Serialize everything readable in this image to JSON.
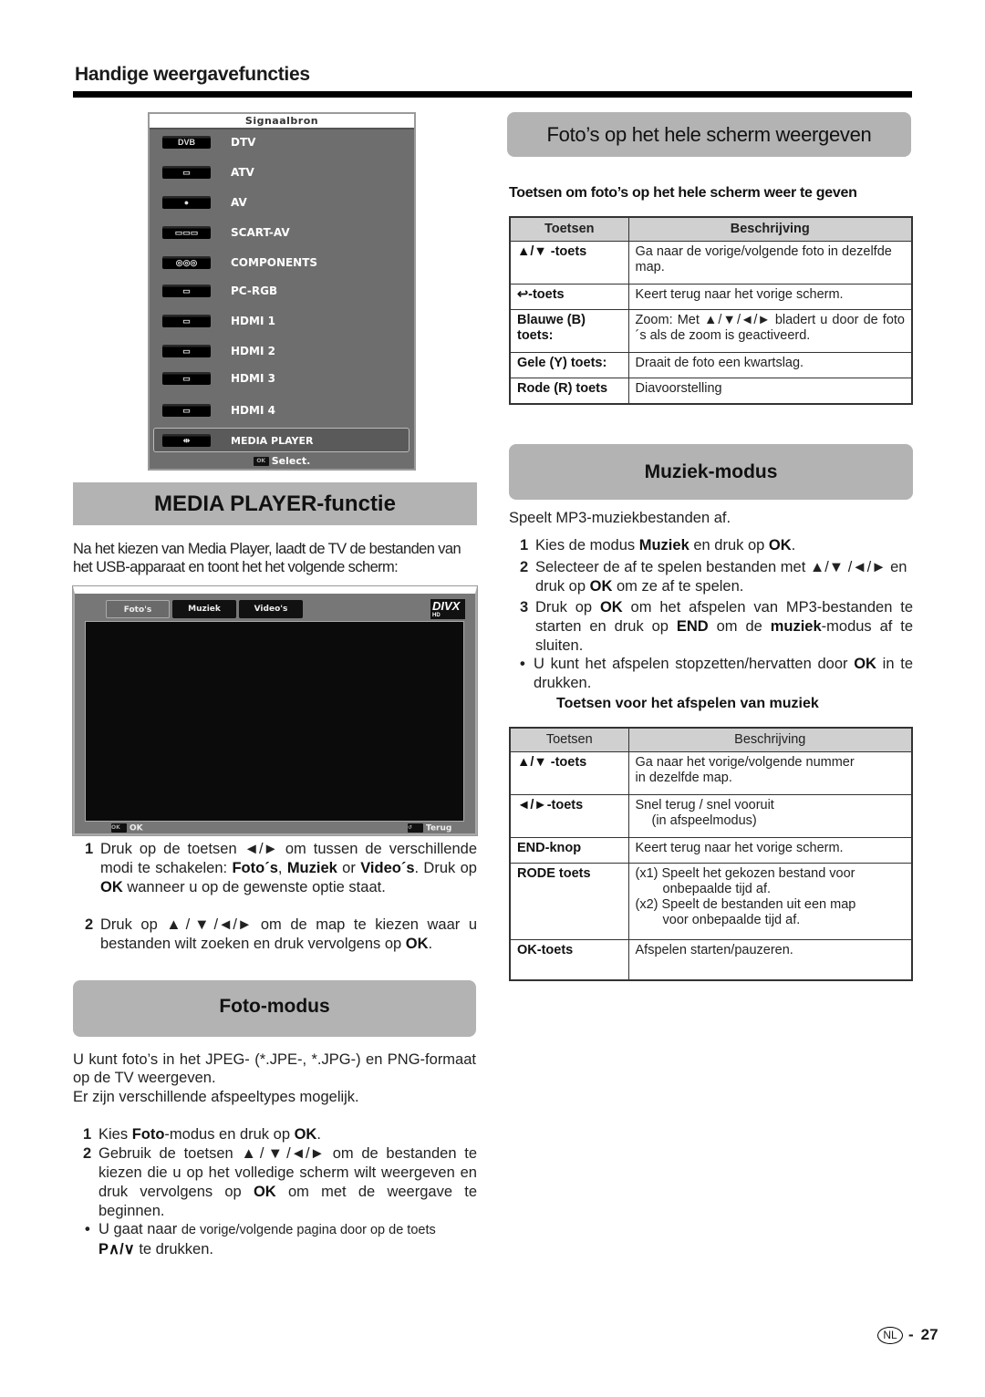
{
  "header": {
    "title": "Handige weergavefuncties"
  },
  "source_menu": {
    "title": "Signaalbron",
    "items": [
      {
        "icon": "dvb-icon",
        "glyph": "DVB",
        "label": "DTV"
      },
      {
        "icon": "tv-icon",
        "glyph": "▭",
        "label": "ATV"
      },
      {
        "icon": "av-jack-icon",
        "glyph": "●",
        "label": "AV"
      },
      {
        "icon": "scart-icon",
        "glyph": "▭▭▭",
        "label": "SCART-AV"
      },
      {
        "icon": "component-icon",
        "glyph": "◎◎◎",
        "label": "COMPONENTS"
      },
      {
        "icon": "vga-icon",
        "glyph": "▭",
        "label": "PC-RGB"
      },
      {
        "icon": "hdmi-icon",
        "glyph": "▭",
        "label": "HDMI 1"
      },
      {
        "icon": "hdmi-icon",
        "glyph": "▭",
        "label": "HDMI 2"
      },
      {
        "icon": "hdmi-icon",
        "glyph": "▭",
        "label": "HDMI 3"
      },
      {
        "icon": "hdmi-icon",
        "glyph": "▭",
        "label": "HDMI 4"
      },
      {
        "icon": "usb-icon",
        "glyph": "⇹",
        "label": "MEDIA PLAYER"
      }
    ],
    "selected": "MEDIA PLAYER",
    "footer_key": "OK",
    "footer_label": "Select."
  },
  "media_player": {
    "title": "MEDIA PLAYER-functie",
    "intro": "Na het kiezen van Media Player, laadt de TV de bestanden van het USB-apparaat en toont het het volgende scherm:",
    "screen": {
      "tabs": [
        "Foto's",
        "Muziek",
        "Video's"
      ],
      "active_tab": "Foto's",
      "logo": "DIVX",
      "logo_sub": "HD",
      "footer_ok": "OK",
      "footer_back": "Terug",
      "ok_key": "OK",
      "back_key": "↺"
    },
    "steps": [
      {
        "num": "1",
        "parts": [
          "Druk op de toetsen ◄/► om tussen de verschillende modi te schakelen: ",
          "Foto´s",
          ", ",
          "Muziek",
          " or ",
          "Video´s",
          ". Druk op ",
          "OK",
          " wanneer u op de gewenste optie staat."
        ]
      },
      {
        "num": "2",
        "parts": [
          "Druk op ▲/▼/◄/► om de map te kiezen waar u bestanden wilt zoeken en druk vervolgens op ",
          "OK",
          "."
        ]
      }
    ]
  },
  "foto_modus": {
    "title": "Foto-modus",
    "intro1": "U kunt foto’s in het JPEG- (*.JPE-, *.JPG-) en PNG-formaat op de TV weergeven.",
    "intro2": "Er zijn verschillende afspeeltypes mogelijk.",
    "step1": {
      "num": "1",
      "a": "Kies ",
      "b": "Foto",
      "c": "-modus en druk op ",
      "d": "OK",
      "e": "."
    },
    "step2": {
      "num": "2",
      "a": "Gebruik de toetsen ▲/▼/◄/► om de bestanden te kiezen die u op het volledige scherm wilt weergeven en druk vervolgens op ",
      "b": "OK",
      "c": " om met de weergave te beginnen."
    },
    "bullet": {
      "a": "U gaat naar ",
      "b": "de vorige/volgende pagina door op de toets",
      "key": "P∧/∨",
      "c": " te drukken."
    }
  },
  "fullscreen": {
    "title": "Foto’s op het hele scherm weergeven",
    "subtitle": "Toetsen om foto’s op het hele scherm weer te geven",
    "table": {
      "headers": [
        "Toetsen",
        "Beschrijving"
      ],
      "rows": [
        {
          "key": "▲/▼ -toets",
          "desc": "Ga naar de vorige/volgende foto in dezelfde map."
        },
        {
          "key": "↩-toets",
          "desc": "Keert terug naar het vorige scherm."
        },
        {
          "key": "Blauwe (B) toets:",
          "desc": "Zoom: Met ▲/▼/◄/► bladert u door de foto´s als de zoom is geactiveerd."
        },
        {
          "key": "Gele (Y) toets:",
          "desc": "Draait de foto een kwartslag."
        },
        {
          "key": "Rode (R) toets",
          "desc": "Diavoorstelling"
        }
      ]
    }
  },
  "muziek": {
    "title": "Muziek-modus",
    "intro": "Speelt MP3-muziekbestanden af.",
    "step1": {
      "num": "1",
      "a": "Kies de modus ",
      "b": "Muziek",
      "c": " en druk op ",
      "d": "OK",
      "e": "."
    },
    "step2": {
      "num": "2",
      "a": "Selecteer de af te spelen bestanden met ▲/▼ /◄/► en druk op ",
      "b": "OK",
      "c": " om ze af te spelen."
    },
    "step3": {
      "num": "3",
      "a": "Druk op ",
      "b": "OK",
      "c": " om het afspelen van MP3-bestanden te starten en druk op ",
      "d": "END",
      "e": " om de ",
      "f": "muziek",
      "g": "-modus af te sluiten."
    },
    "bullet": {
      "a": "U kunt het afspelen stopzetten/hervatten door ",
      "b": "OK",
      "c": " in te drukken."
    },
    "subtitle": "Toetsen voor het afspelen van muziek",
    "table": {
      "headers": [
        "Toetsen",
        "Beschrijving"
      ],
      "rows": [
        {
          "key": "▲/▼ -toets",
          "desc": [
            "Ga naar het vorige/volgende nummer",
            "in dezelfde map."
          ]
        },
        {
          "key": "◄/►-toets",
          "desc": [
            "Snel terug / snel vooruit",
            "(in afspeelmodus)"
          ]
        },
        {
          "key": "END-knop",
          "desc": [
            "Keert terug naar het vorige scherm."
          ]
        },
        {
          "key": "RODE toets",
          "desc": [
            "(x1) Speelt het gekozen bestand voor",
            "onbepaalde tijd af.",
            "(x2) Speelt de bestanden uit een map",
            "voor onbepaalde tijd af."
          ]
        },
        {
          "key": "OK-toets",
          "desc": [
            "Afspelen starten/pauzeren."
          ]
        }
      ]
    }
  },
  "footer": {
    "lang": "NL",
    "sep": "-",
    "page": "27"
  }
}
